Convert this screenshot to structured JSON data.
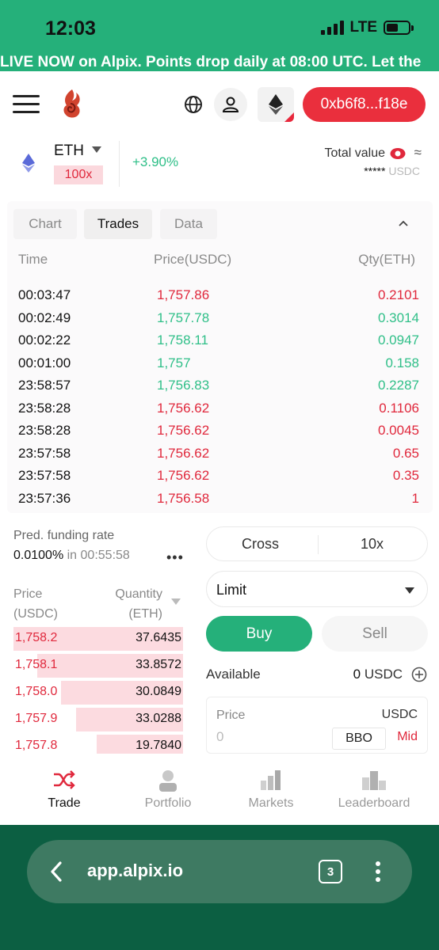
{
  "status_bar": {
    "time": "12:03",
    "network": "LTE"
  },
  "marquee": {
    "text": "LIVE NOW on Alpix. Points drop daily at 08:00 UTC. Let the"
  },
  "header": {
    "wallet_address": "0xb6f8...f18e"
  },
  "market": {
    "symbol": "ETH",
    "leverage": "100x",
    "change": "+3.90%",
    "total_value_label": "Total value",
    "approx_symbol": "≈",
    "total_value_masked": "*****",
    "total_value_unit": "USDC"
  },
  "trades_panel": {
    "tabs": [
      {
        "label": "Chart"
      },
      {
        "label": "Trades"
      },
      {
        "label": "Data"
      }
    ],
    "active_tab": "Trades",
    "columns": {
      "time": "Time",
      "price": "Price(USDC)",
      "qty": "Qty(ETH)"
    },
    "rows": [
      {
        "time": "00:03:47",
        "price": "1,757.86",
        "qty": "0.2101",
        "side": "sell"
      },
      {
        "time": "00:02:49",
        "price": "1,757.78",
        "qty": "0.3014",
        "side": "buy"
      },
      {
        "time": "00:02:22",
        "price": "1,758.11",
        "qty": "0.0947",
        "side": "buy"
      },
      {
        "time": "00:01:00",
        "price": "1,757",
        "qty": "0.158",
        "side": "buy"
      },
      {
        "time": "23:58:57",
        "price": "1,756.83",
        "qty": "0.2287",
        "side": "buy"
      },
      {
        "time": "23:58:28",
        "price": "1,756.62",
        "qty": "0.1106",
        "side": "sell"
      },
      {
        "time": "23:58:28",
        "price": "1,756.62",
        "qty": "0.0045",
        "side": "sell"
      },
      {
        "time": "23:57:58",
        "price": "1,756.62",
        "qty": "0.65",
        "side": "sell"
      },
      {
        "time": "23:57:58",
        "price": "1,756.62",
        "qty": "0.35",
        "side": "sell"
      },
      {
        "time": "23:57:36",
        "price": "1,756.58",
        "qty": "1",
        "side": "sell"
      }
    ]
  },
  "funding": {
    "label": "Pred. funding rate",
    "rate": "0.0100%",
    "in_text": "in",
    "countdown": "00:55:58",
    "more_glyph": "•••"
  },
  "orderbook": {
    "price_header_1": "Price",
    "price_header_2": "(USDC)",
    "qty_header_1": "Quantity",
    "qty_header_2": "(ETH)",
    "asks": [
      {
        "price": "1,758.2",
        "qty": "37.6435",
        "depth": 1.0
      },
      {
        "price": "1,758.1",
        "qty": "33.8572",
        "depth": 0.86
      },
      {
        "price": "1,758.0",
        "qty": "30.0849",
        "depth": 0.72
      },
      {
        "price": "1,757.9",
        "qty": "33.0288",
        "depth": 0.63
      },
      {
        "price": "1,757.8",
        "qty": "19.7840",
        "depth": 0.51
      }
    ]
  },
  "order_form": {
    "margin_mode": "Cross",
    "leverage": "10x",
    "order_type": "Limit",
    "buy_label": "Buy",
    "sell_label": "Sell",
    "available_label": "Available",
    "available_value": "0",
    "available_unit": "USDC",
    "price_label": "Price",
    "price_unit": "USDC",
    "price_placeholder": "0",
    "bbo_label": "BBO",
    "mid_label": "Mid"
  },
  "bottom_nav": {
    "items": [
      {
        "label": "Trade",
        "icon": "shuffle-icon"
      },
      {
        "label": "Portfolio",
        "icon": "person-icon"
      },
      {
        "label": "Markets",
        "icon": "bar-chart-icon"
      },
      {
        "label": "Leaderboard",
        "icon": "podium-icon"
      }
    ],
    "active": "Trade"
  },
  "browser": {
    "url": "app.alpix.io",
    "tab_count": "3"
  },
  "colors": {
    "brand_green": "#25b07a",
    "sell_red": "#e0283c",
    "buy_green": "#2fbf88",
    "wallet_red": "#ea2f3d",
    "browser_bg": "#0c5f42"
  }
}
